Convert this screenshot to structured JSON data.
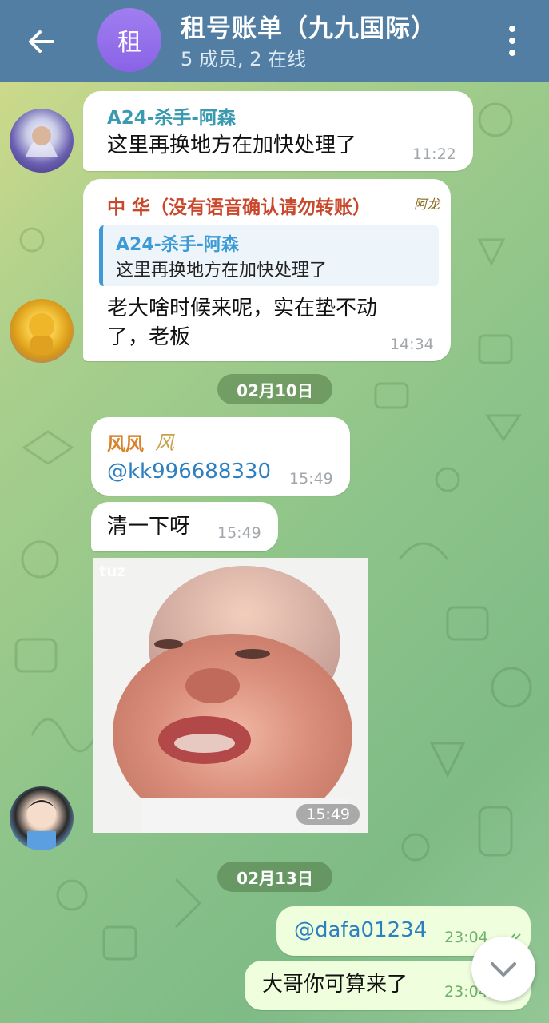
{
  "header": {
    "avatar_letter": "租",
    "title": "租号账单（九九国际）",
    "subtitle": "5 成员, 2 在线"
  },
  "messages": [
    {
      "sender": "A24-杀手-阿森",
      "text": "这里再换地方在加快处理了",
      "time": "11:22"
    },
    {
      "sender": "中 华（没有语音确认请勿转账）",
      "sender_badge": "阿龙",
      "quote_sender": "A24-杀手-阿森",
      "quote_text": "这里再换地方在加快处理了",
      "text_line1": "老大啥时候来呢，实在垫不动",
      "text_line2": "了，老板",
      "time": "14:34"
    },
    {
      "sender": "风风",
      "sender_badge": "风",
      "text": "@kk996688330",
      "time": "15:49"
    },
    {
      "text": "清一下呀",
      "time": "15:49"
    },
    {
      "sticker_watermark": "tuz",
      "time": "15:49"
    },
    {
      "text": "@dafa01234",
      "time": "23:04"
    },
    {
      "text": "大哥你可算来了",
      "time": "23:04"
    }
  ],
  "dates": [
    "02月10日",
    "02月13日"
  ],
  "colors": {
    "header": "#527ea3",
    "sender_a24": "#3a9ab0",
    "sender_zhonghua": "#c9482b",
    "sender_fengfeng": "#d9822b",
    "quote_accent": "#3c9bd6",
    "outgoing_bubble": "#efffde"
  },
  "icons": {
    "back": "arrow-left-icon",
    "more": "more-vertical-icon",
    "scroll": "chevron-down-icon",
    "read": "double-check-icon"
  }
}
